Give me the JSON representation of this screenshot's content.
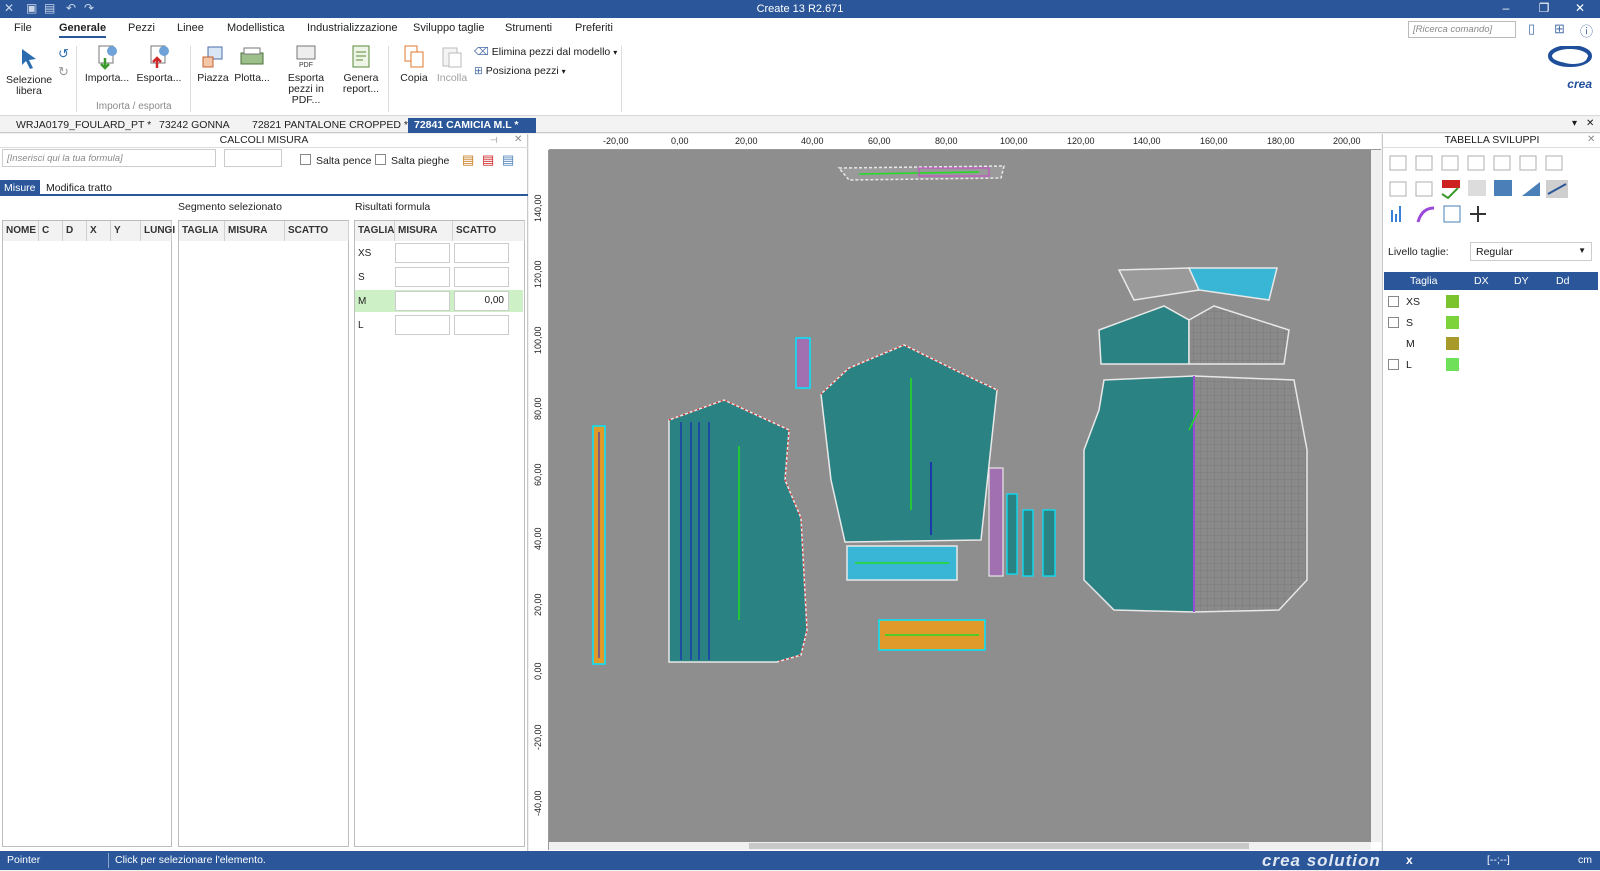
{
  "app": {
    "title": "Create 13 R2.671"
  },
  "menu": [
    "File",
    "Generale",
    "Pezzi",
    "Linee",
    "Modellistica",
    "Industrializzazione",
    "Sviluppo taglie",
    "Strumenti",
    "Preferiti"
  ],
  "search": {
    "placeholder": "[Ricerca comando]"
  },
  "ribbon": {
    "selezione": "Selezione libera",
    "importa": "Importa...",
    "esporta": "Esporta...",
    "group_importa": "Importa / esporta",
    "piazza": "Piazza",
    "plotta": "Plotta...",
    "esporta_pdf": "Esporta pezzi in PDF...",
    "genera": "Genera report...",
    "copia": "Copia",
    "incolla": "Incolla",
    "elimina": "Elimina pezzi dal modello",
    "posiziona": "Posiziona pezzi",
    "pdf_tag": "PDF"
  },
  "brand_logo": "crea",
  "tabs": [
    "WRJA0179_FOULARD_PT *",
    "73242 GONNA",
    "72821 PANTALONE CROPPED *",
    "72841 CAMICIA M.L *"
  ],
  "left": {
    "title": "CALCOLI MISURA",
    "formula_placeholder": "[Inserisci qui la tua formula]",
    "salta_pence": "Salta pence",
    "salta_pieghe": "Salta pieghe",
    "subtabs": [
      "Misure",
      "Modifica tratto"
    ],
    "segmento": "Segmento selezionato",
    "risultati": "Risultati formula",
    "grid1_cols": [
      "NOME",
      "C",
      "D",
      "X",
      "Y",
      "LUNGI"
    ],
    "grid2_cols": [
      "TAGLIA",
      "MISURA",
      "SCATTO"
    ],
    "grid3_cols": [
      "TAGLIA",
      "MISURA",
      "SCATTO"
    ],
    "sizes": [
      "XS",
      "S",
      "M",
      "L"
    ],
    "m_scatto": "0,00"
  },
  "ruler": {
    "top": [
      "-20,00",
      "0,00",
      "20,00",
      "40,00",
      "60,00",
      "80,00",
      "100,00",
      "120,00",
      "140,00",
      "160,00",
      "180,00",
      "200,00"
    ],
    "left": [
      "140,00",
      "120,00",
      "100,00",
      "80,00",
      "60,00",
      "40,00",
      "20,00",
      "0,00",
      "-20,00",
      "-40,00"
    ]
  },
  "right": {
    "title": "TABELLA SVILUPPI",
    "livello_label": "Livello taglie:",
    "livello_value": "Regular",
    "cols": [
      "Taglia",
      "DX",
      "DY",
      "Dd"
    ],
    "rows": [
      {
        "size": "XS",
        "color": "#7cc42e"
      },
      {
        "size": "S",
        "color": "#7cd43a"
      },
      {
        "size": "M",
        "color": "#a89a2a"
      },
      {
        "size": "L",
        "color": "#6ee05a"
      }
    ]
  },
  "status": {
    "mode": "Pointer",
    "hint": "Click per selezionare l'elemento.",
    "brand": "crea solution",
    "coords": "[--;--]",
    "unit": "cm"
  }
}
